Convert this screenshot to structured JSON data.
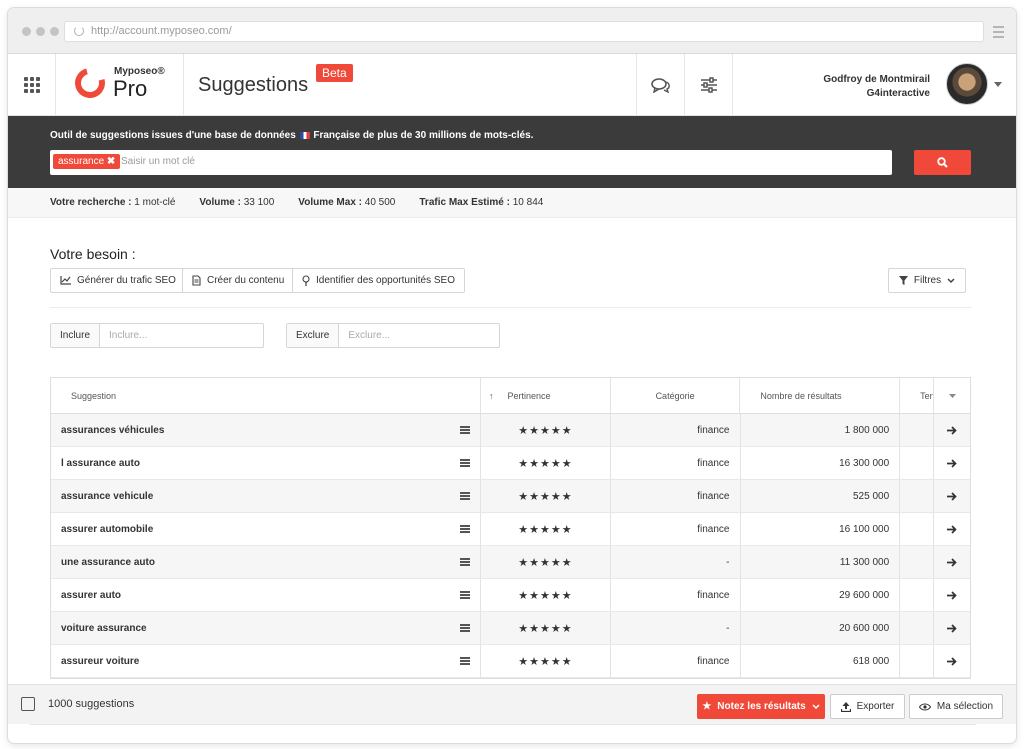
{
  "browser": {
    "url": "http://account.myposeo.com/"
  },
  "header": {
    "brand_small": "Myposeo®",
    "brand_big": "Pro",
    "page_title": "Suggestions",
    "beta": "Beta",
    "user_name": "Godfroy de Montmirail",
    "user_company": "G4interactive"
  },
  "search": {
    "description_before": "Outil de suggestions issues d'une base de données",
    "description_after": "Française de plus de 30 millions de mots-clés.",
    "chip": "assurance",
    "placeholder": "Saisir un mot clé"
  },
  "stats": {
    "recherche_label": "Votre recherche :",
    "recherche_value": "1 mot-clé",
    "volume_label": "Volume :",
    "volume_value": "33 100",
    "volume_max_label": "Volume Max :",
    "volume_max_value": "40 500",
    "trafic_label": "Trafic Max Estimé :",
    "trafic_value": "10 844"
  },
  "besoin": {
    "title": "Votre besoin :",
    "options": [
      "Générer du trafic SEO",
      "Créer du contenu",
      "Identifier des opportunités SEO"
    ],
    "filtres": "Filtres"
  },
  "filters": {
    "include_label": "Inclure",
    "include_placeholder": "Inclure...",
    "exclude_label": "Exclure",
    "exclude_placeholder": "Exclure..."
  },
  "table": {
    "headers": [
      "Suggestion",
      "Pertinence",
      "Catégorie",
      "Nombre de résultats",
      "Ten"
    ],
    "stars": "★★★★★",
    "rows": [
      {
        "keyword": "assurances véhicules",
        "category": "finance",
        "results": "1 800 000"
      },
      {
        "keyword": "l assurance auto",
        "category": "finance",
        "results": "16 300 000"
      },
      {
        "keyword": "assurance vehicule",
        "category": "finance",
        "results": "525 000"
      },
      {
        "keyword": "assurer automobile",
        "category": "finance",
        "results": "16 100 000"
      },
      {
        "keyword": "une assurance auto",
        "category": "-",
        "results": "11 300 000"
      },
      {
        "keyword": "assurer auto",
        "category": "finance",
        "results": "29 600 000"
      },
      {
        "keyword": "voiture assurance",
        "category": "-",
        "results": "20 600 000"
      },
      {
        "keyword": "assureur voiture",
        "category": "finance",
        "results": "618 000"
      }
    ]
  },
  "footer": {
    "count": "1000 suggestions",
    "notez": "Notez les résultats",
    "exporter": "Exporter",
    "selection": "Ma sélection"
  },
  "colors": {
    "accent": "#f0493a",
    "band": "#3b3b3b"
  }
}
